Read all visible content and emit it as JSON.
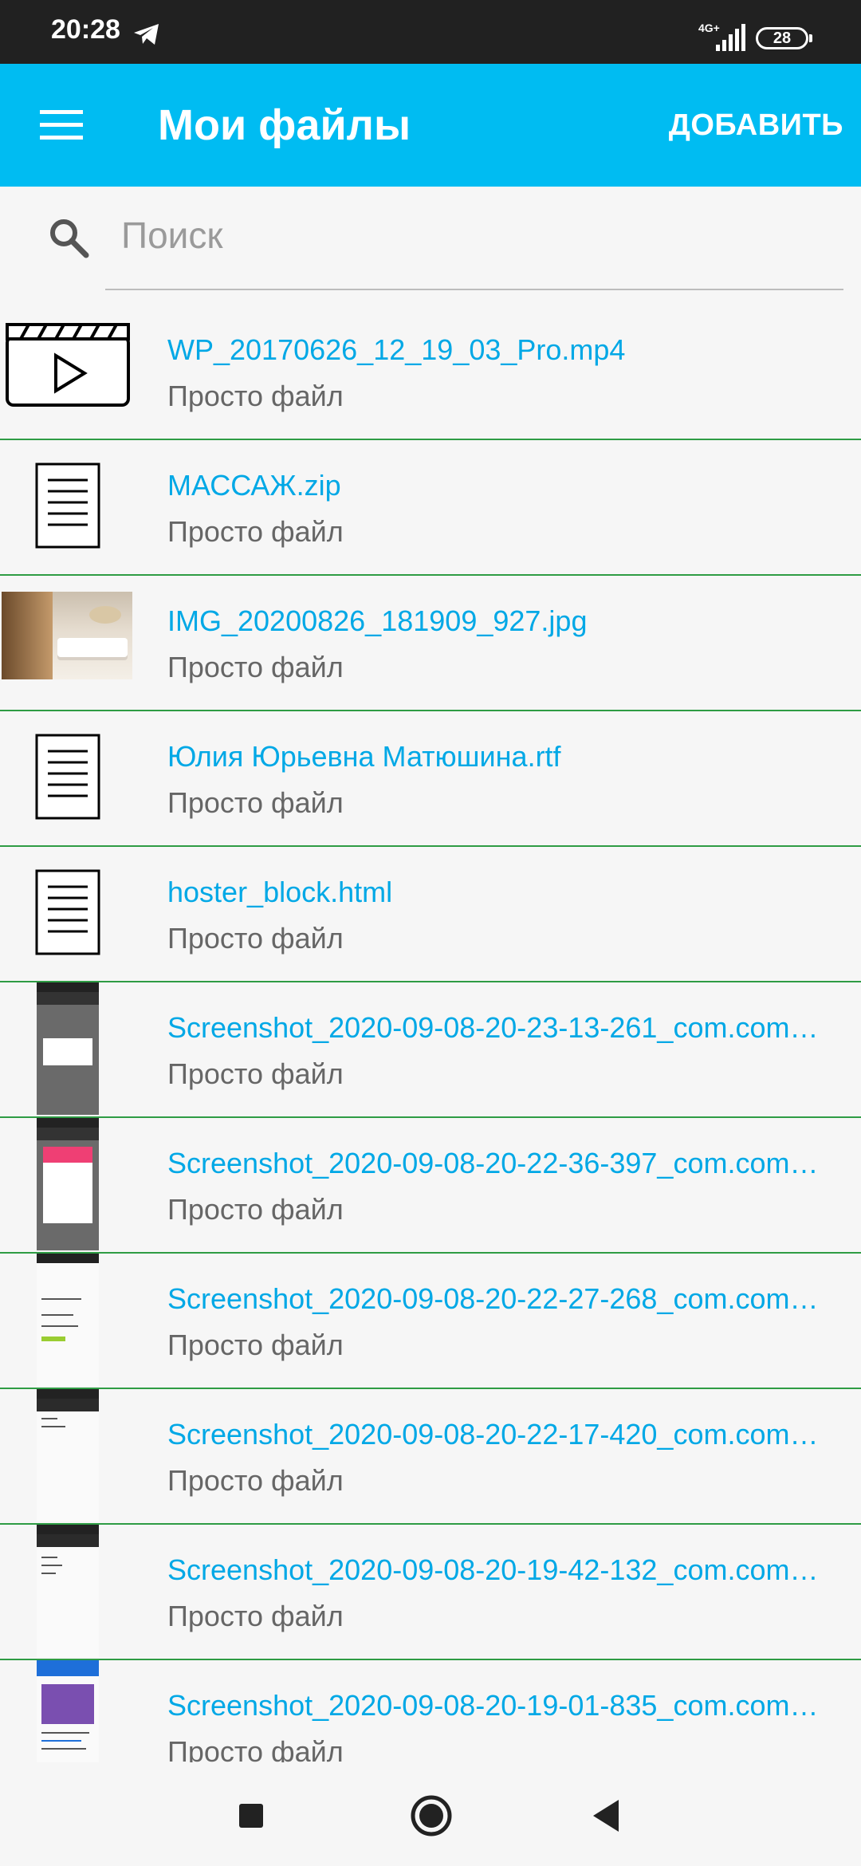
{
  "status_bar": {
    "time": "20:28",
    "network": "4G+",
    "battery": "28"
  },
  "app_bar": {
    "title": "Мои файлы",
    "add_label": "ДОБАВИТЬ"
  },
  "search": {
    "placeholder": "Поиск"
  },
  "files": [
    {
      "name": "WP_20170626_12_19_03_Pro.mp4",
      "subtitle": "Просто файл",
      "thumb": "video-icon"
    },
    {
      "name": "МАССАЖ.zip",
      "subtitle": "Просто файл",
      "thumb": "document-icon"
    },
    {
      "name": "IMG_20200826_181909_927.jpg",
      "subtitle": "Просто файл",
      "thumb": "photo-thumbnail"
    },
    {
      "name": "Юлия Юрьевна Матюшина.rtf",
      "subtitle": "Просто файл",
      "thumb": "document-icon"
    },
    {
      "name": "hoster_block.html",
      "subtitle": "Просто файл",
      "thumb": "document-icon"
    },
    {
      "name": "Screenshot_2020-09-08-20-23-13-261_com.com…",
      "subtitle": "Просто файл",
      "thumb": "screenshot-thumbnail"
    },
    {
      "name": "Screenshot_2020-09-08-20-22-36-397_com.com…",
      "subtitle": "Просто файл",
      "thumb": "screenshot-thumbnail"
    },
    {
      "name": "Screenshot_2020-09-08-20-22-27-268_com.com…",
      "subtitle": "Просто файл",
      "thumb": "screenshot-thumbnail"
    },
    {
      "name": "Screenshot_2020-09-08-20-22-17-420_com.com…",
      "subtitle": "Просто файл",
      "thumb": "screenshot-thumbnail"
    },
    {
      "name": "Screenshot_2020-09-08-20-19-42-132_com.com…",
      "subtitle": "Просто файл",
      "thumb": "screenshot-thumbnail"
    },
    {
      "name": "Screenshot_2020-09-08-20-19-01-835_com.com…",
      "subtitle": "Просто файл",
      "thumb": "screenshot-thumbnail"
    }
  ],
  "colors": {
    "accent": "#00bcf2",
    "link": "#00a8e6",
    "divider": "#2e9c44",
    "status_bar": "#212121"
  }
}
